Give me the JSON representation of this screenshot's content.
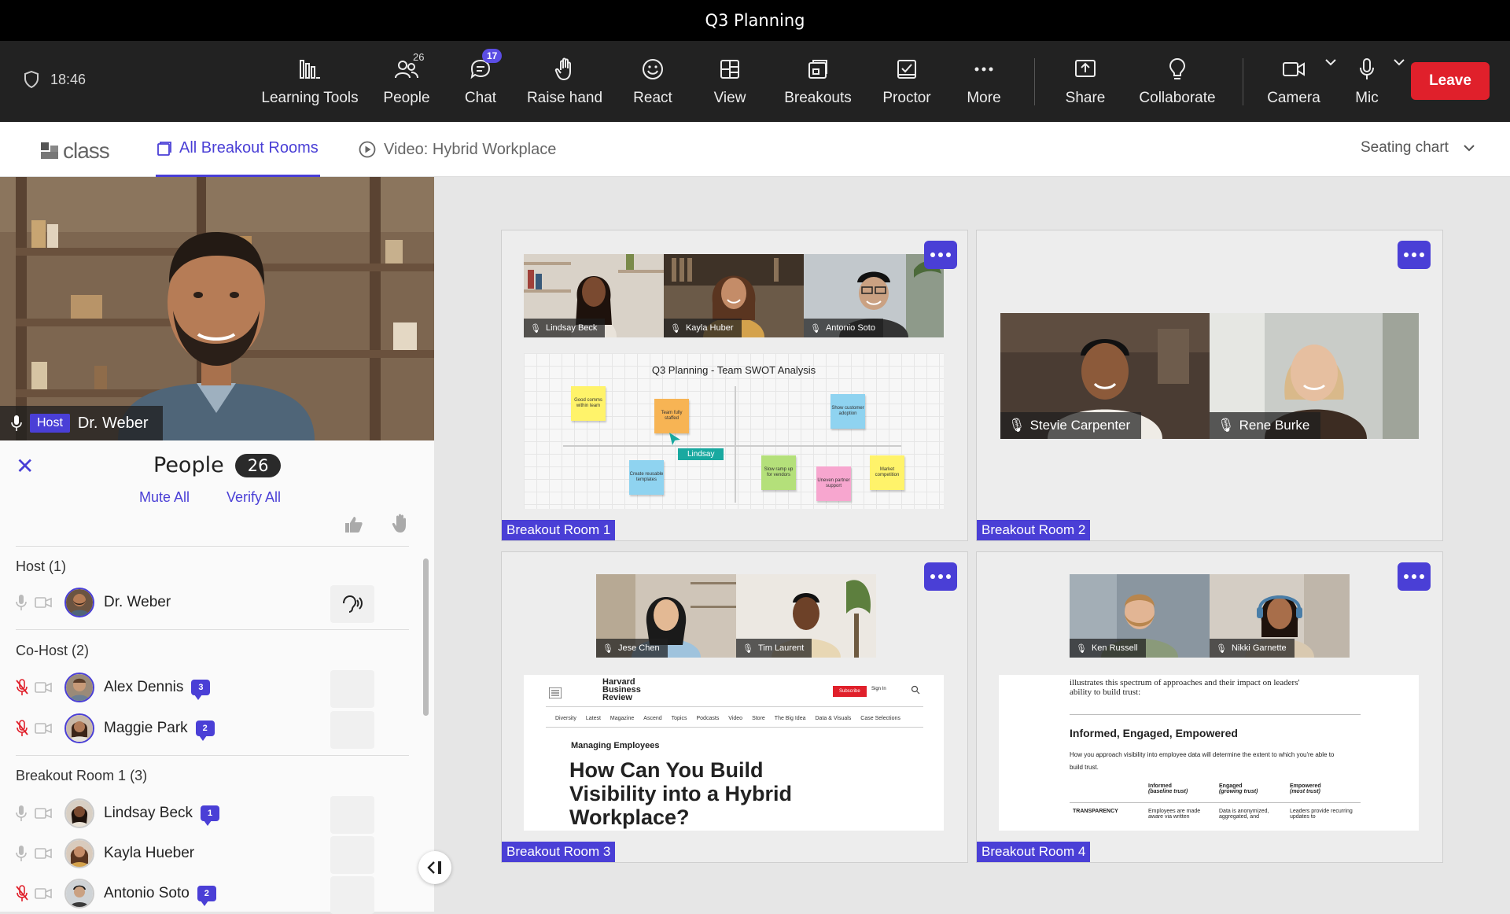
{
  "window": {
    "title": "Q3 Planning"
  },
  "toolbar": {
    "time": "18:46",
    "items": [
      {
        "label": "Learning Tools"
      },
      {
        "label": "People",
        "count": "26"
      },
      {
        "label": "Chat",
        "badge": "17"
      },
      {
        "label": "Raise hand"
      },
      {
        "label": "React"
      },
      {
        "label": "View"
      },
      {
        "label": "Breakouts"
      },
      {
        "label": "Proctor"
      },
      {
        "label": "More"
      },
      {
        "label": "Share"
      },
      {
        "label": "Collaborate"
      },
      {
        "label": "Camera"
      },
      {
        "label": "Mic"
      }
    ],
    "leave_label": "Leave"
  },
  "tabs": {
    "logo": "class",
    "items": [
      {
        "label": "All Breakout Rooms",
        "active": true
      },
      {
        "label": "Video: Hybrid Workplace",
        "active": false
      }
    ],
    "seating_label": "Seating chart"
  },
  "host_video": {
    "tag": "Host",
    "name": "Dr. Weber"
  },
  "people_panel": {
    "title": "People",
    "count": "26",
    "mute_all": "Mute All",
    "verify_all": "Verify All",
    "groups": [
      {
        "title": "Host (1)",
        "people": [
          {
            "name": "Dr. Weber",
            "muted": false
          }
        ]
      },
      {
        "title": "Co-Host (2)",
        "people": [
          {
            "name": "Alex Dennis",
            "muted": true,
            "chat": "3"
          },
          {
            "name": "Maggie Park",
            "muted": true,
            "chat": "2"
          }
        ]
      },
      {
        "title": "Breakout Room 1 (3)",
        "people": [
          {
            "name": "Lindsay Beck",
            "muted": false,
            "chat": "1"
          },
          {
            "name": "Kayla Hueber",
            "muted": false
          },
          {
            "name": "Antonio Soto",
            "muted": true,
            "chat": "2"
          }
        ]
      }
    ]
  },
  "rooms": [
    {
      "label": "Breakout Room 1",
      "participants": [
        "Lindsay Beck",
        "Kayla Huber",
        "Antonio Soto"
      ],
      "board": {
        "title": "Q3 Planning - Team SWOT Analysis",
        "cursor_label": "Lindsay",
        "notes": [
          "Good comms within team",
          "Team fully staffed",
          "Show customer adoption",
          "Create reusable templates",
          "Slow ramp up for vendors",
          "Uneven partner support",
          "Market competition"
        ]
      }
    },
    {
      "label": "Breakout Room 2",
      "participants": [
        "Stevie Carpenter",
        "Rene Burke"
      ]
    },
    {
      "label": "Breakout Room 3",
      "participants": [
        "Jese Chen",
        "Tim Laurent"
      ],
      "article": {
        "brand_1": "Harvard",
        "brand_2": "Business",
        "brand_3": "Review",
        "subscribe": "Subscribe",
        "signin": "Sign In",
        "nav": [
          "Diversity",
          "Latest",
          "Magazine",
          "Ascend",
          "Topics",
          "Podcasts",
          "Video",
          "Store",
          "The Big Idea",
          "Data & Visuals",
          "Case Selections"
        ],
        "kicker": "Managing Employees",
        "headline_1": "How Can You Build",
        "headline_2": "Visibility into a Hybrid",
        "headline_3": "Workplace?"
      }
    },
    {
      "label": "Breakout Room 4",
      "participants": [
        "Ken Russell",
        "Nikki Garnette"
      ],
      "doc": {
        "intro_1": "illustrates this spectrum of approaches and their impact on leaders'",
        "intro_2": "ability to build trust:",
        "heading": "Informed, Engaged, Empowered",
        "body_1": "How you approach visibility into employee data will determine the extent to which you're able to",
        "body_2": "build trust.",
        "col1": "Informed",
        "col1s": "(baseline trust)",
        "col2": "Engaged",
        "col2s": "(growing trust)",
        "col3": "Empowered",
        "col3s": "(most trust)",
        "row": "TRANSPARENCY",
        "c1": "Employees are made aware via written",
        "c2": "Data is anonymized, aggregated, and",
        "c3": "Leaders provide recurring updates to"
      }
    }
  ],
  "colors": {
    "accent": "#4a3fd6",
    "leave": "#e0202b",
    "muted": "#e0202b"
  }
}
